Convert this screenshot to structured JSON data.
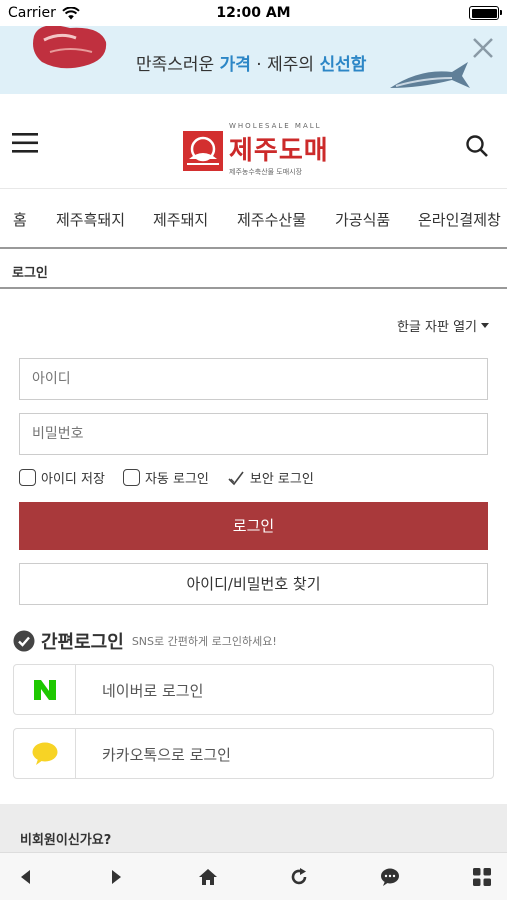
{
  "status_bar": {
    "carrier": "Carrier",
    "time": "12:00 AM"
  },
  "banner": {
    "text_part1": "만족스러운 ",
    "text_highlight1": "가격",
    "text_part2": " · 제주의 ",
    "text_highlight2": "신선함",
    "highlight_color": "#2c86c6"
  },
  "header": {
    "logo_en": "WHOLESALE MALL",
    "logo_name": "제주도매",
    "logo_sub": "제주농수축산물 도매시장",
    "brand_color": "#cc2a2a"
  },
  "nav": {
    "items": [
      {
        "label": "홈"
      },
      {
        "label": "제주흑돼지"
      },
      {
        "label": "제주돼지"
      },
      {
        "label": "제주수산물"
      },
      {
        "label": "가공식품"
      },
      {
        "label": "온라인결제창"
      }
    ]
  },
  "breadcrumb": {
    "label": "로그인"
  },
  "keyboard_toggle": {
    "label": "한글 자판 열기"
  },
  "form": {
    "id_placeholder": "아이디",
    "pw_placeholder": "비밀번호",
    "save_id_label": "아이디 저장",
    "auto_login_label": "자동 로그인",
    "secure_login_label": "보안 로그인",
    "login_button": "로그인",
    "login_button_color": "#a9393b",
    "find_button": "아이디/비밀번호 찾기"
  },
  "easy_login": {
    "title": "간편로그인",
    "desc": "SNS로 간편하게 로그인하세요!",
    "naver_label": "네이버로 로그인",
    "naver_color": "#1ec800",
    "kakao_label": "카카오톡으로 로그인",
    "kakao_color": "#f7d325"
  },
  "guest": {
    "label": "비회원이신가요?"
  },
  "toolbar": {
    "icons": [
      "back-icon",
      "forward-icon",
      "home-icon",
      "refresh-icon",
      "chat-icon",
      "grid-icon"
    ]
  }
}
